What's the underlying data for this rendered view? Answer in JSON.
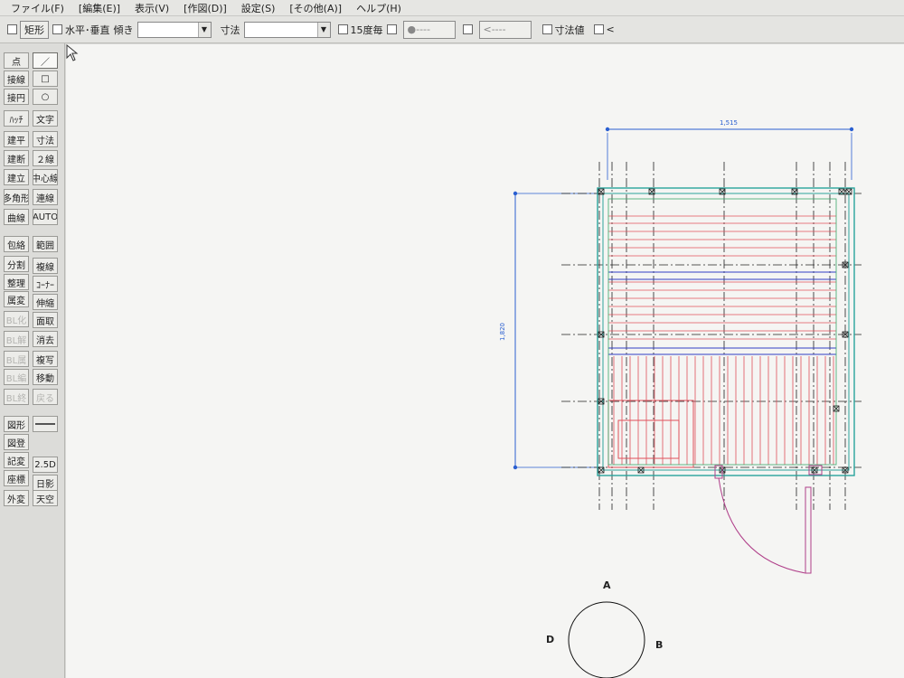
{
  "menu": {
    "file": "ファイル(F)",
    "edit": "[編集(E)]",
    "view": "表示(V)",
    "draw": "[作図(D)]",
    "settings": "設定(S)",
    "other": "[その他(A)]",
    "help": "ヘルプ(H)"
  },
  "options": {
    "rect": "矩形",
    "hv": "水平･垂直",
    "tilt": "傾き",
    "dim": "寸法",
    "deg15": "15度毎",
    "dot_line": "●----",
    "arrow_line": "<----",
    "dim_value": "寸法値",
    "lt": "<"
  },
  "tools": {
    "point": "点",
    "line": "／",
    "tangent": "接線",
    "rect": "□",
    "tangent_circle": "接円",
    "circle": "○",
    "hatch": "ﾊｯﾁ",
    "text": "文字",
    "plan": "建平",
    "dim": "寸法",
    "section": "建断",
    "double": "２線",
    "elevation": "建立",
    "center": "中心線",
    "polygon": "多角形",
    "continuous": "連線",
    "curve": "曲線",
    "auto": "AUTO",
    "enclose": "包絡",
    "range": "範囲",
    "divide": "分割",
    "copy_line": "複線",
    "arrange": "整理",
    "corner": "ｺｰﾅｰ",
    "attribute": "属変",
    "stretch": "伸縮",
    "bl1": "BL化",
    "face": "面取",
    "bl2": "BL解",
    "erase": "消去",
    "bl3": "BL属",
    "duplicate": "複写",
    "bl4": "BL編",
    "move": "移動",
    "bl5": "BL終",
    "back": "戻る",
    "figure": "図形",
    "layer_line": "",
    "layer": "図登",
    "record": "記変",
    "coord25d": "2.5D",
    "coord": "座標",
    "shadow": "日影",
    "exterior": "外変",
    "sky": "天空"
  },
  "drawing": {
    "dim_top": "1,515",
    "dim_left": "1,820",
    "compass": {
      "a": "A",
      "b": "B",
      "d": "D"
    }
  },
  "colors": {
    "wall": "#2aa39b",
    "dim": "#2a5fd1",
    "floor_red": "#e0505a",
    "blue_line": "#3340c4",
    "door": "#b0408a",
    "axis": "#222222"
  }
}
